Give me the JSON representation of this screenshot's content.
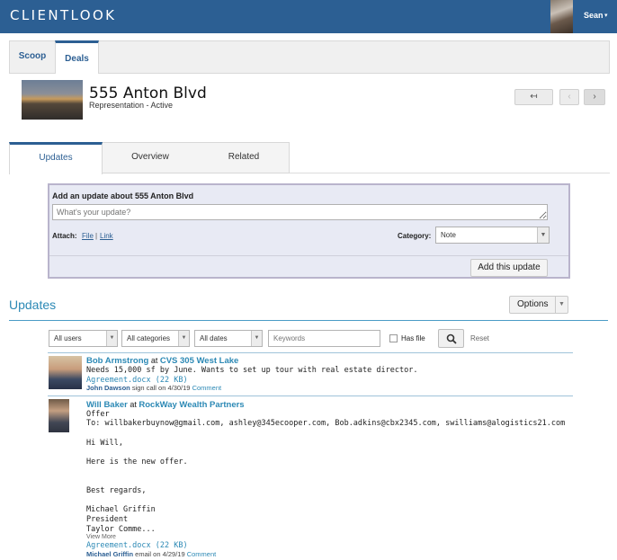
{
  "header": {
    "brand": "CLIENTLOOK",
    "user_name": "Sean",
    "user_caret": "▾"
  },
  "tabs": [
    {
      "label": "Scoop"
    },
    {
      "label": "Deals"
    }
  ],
  "property": {
    "title": "555 Anton Blvd",
    "subtitle": "Representation - Active"
  },
  "nav": {
    "back": "↤",
    "prev": "‹",
    "next": "›"
  },
  "section_tabs": [
    {
      "label": "Updates"
    },
    {
      "label": "Overview"
    },
    {
      "label": "Related"
    }
  ],
  "update_form": {
    "heading": "Add an update about 555 Anton Blvd",
    "placeholder": "What's your update?",
    "attach_label": "Attach:",
    "file_link": "File",
    "separator": "|",
    "link_link": "Link",
    "category_label": "Category:",
    "category_value": "Note",
    "submit": "Add this update"
  },
  "updates": {
    "heading": "Updates",
    "options": "Options",
    "filters": {
      "users": "All users",
      "categories": "All categories",
      "dates": "All dates",
      "keywords_placeholder": "Keywords",
      "has_file": "Has file",
      "reset": "Reset"
    },
    "entries": [
      {
        "author": "Bob Armstrong",
        "at": " at ",
        "org": "CVS 305 West Lake",
        "body": "Needs 15,000 sf by June. Wants to set up tour with real estate director.",
        "attachment": "Agreement.docx (22 KB)",
        "meta_who": "John Dawson",
        "meta_text": " sign call on 4/30/19 ",
        "meta_comment": "Comment"
      },
      {
        "author": "Will Baker",
        "at": " at ",
        "org": "RockWay Wealth Partners",
        "subject": "Offer",
        "to": "To: willbakerbuynow@gmail.com, ashley@345ecooper.com, Bob.adkins@cbx2345.com, swilliams@alogistics21.com",
        "greeting": "Hi Will,",
        "line1": "Here is the new offer.",
        "closing": "Best regards,",
        "sig_name": "Michael Griffin",
        "sig_title": "President",
        "sig_company": "Taylor Comme...",
        "view_more": "View More",
        "attachment": "Agreement.docx (22 KB)",
        "meta_who": "Michael Griffin",
        "meta_text": " email on 4/29/19 ",
        "meta_comment": "Comment"
      }
    ]
  },
  "colors": {
    "header": "#2c5f93",
    "accent": "#2c89b5",
    "form_bg": "#e8eaf4"
  }
}
